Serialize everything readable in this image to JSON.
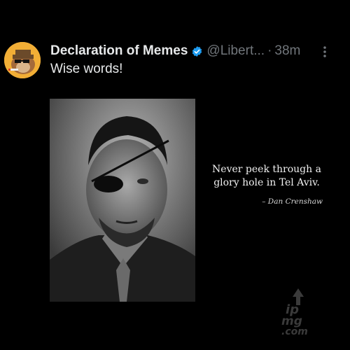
{
  "post": {
    "author_name": "Declaration of Memes",
    "handle": "@Libert...",
    "separator": "·",
    "time": "38m",
    "text": "Wise words!",
    "verified_color": "#1d9bf0"
  },
  "media": {
    "quote_text": "Never peek through a glory hole in Tel Aviv.",
    "attribution": "– Dan Crenshaw",
    "watermark": "imgflip.com"
  },
  "icons": {
    "verified": "verified-badge-icon",
    "more": "more-options-icon"
  }
}
